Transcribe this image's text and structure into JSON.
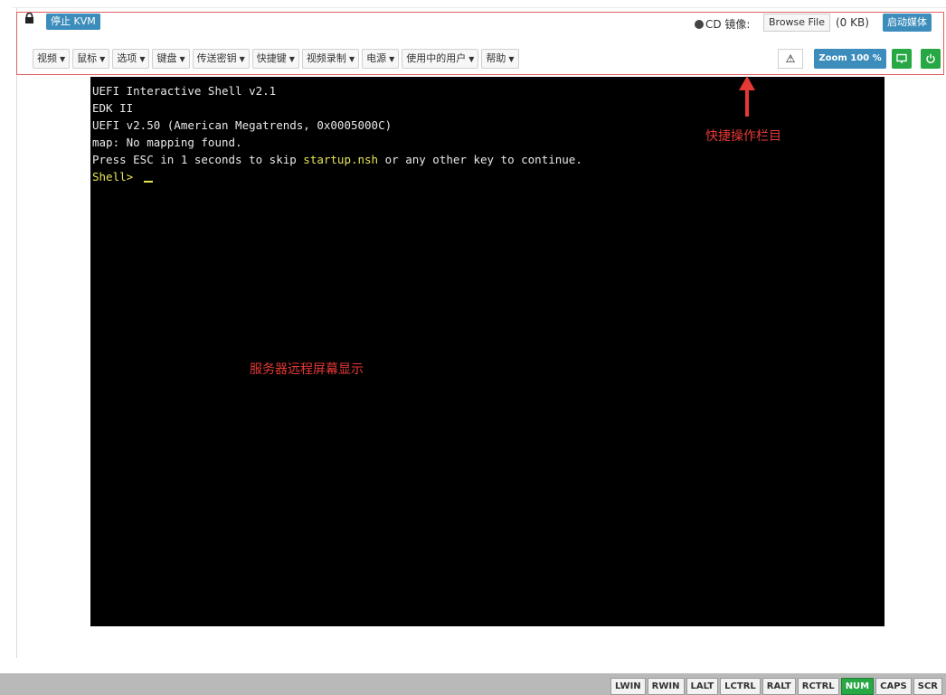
{
  "toolbar": {
    "stop_kvm_label": "停止 KVM",
    "cd_label": "CD 镜像:",
    "browse_file_label": "Browse File",
    "file_size": "(0 KB)",
    "start_media_label": "启动媒体",
    "menus": [
      "视频",
      "鼠标",
      "选项",
      "键盘",
      "传送密钥",
      "快捷键",
      "视频录制",
      "电源",
      "使用中的用户",
      "帮助"
    ],
    "warning_icon": "⚠",
    "zoom_label": "Zoom 100 %"
  },
  "screen": {
    "lines": [
      "UEFI Interactive Shell v2.1",
      "EDK II",
      "UEFI v2.50 (American Megatrends, 0x0005000C)",
      "map: No mapping found."
    ],
    "press_prefix": "Press ESC in 1 seconds to skip ",
    "press_highlight": "startup.nsh",
    "press_suffix": " or any other key to continue.",
    "prompt": "Shell> "
  },
  "annotations": {
    "toolbar_note": "快捷操作栏目",
    "screen_note": "服务器远程屏幕显示"
  },
  "statusbar": {
    "keys": [
      {
        "label": "LWIN",
        "active": false
      },
      {
        "label": "RWIN",
        "active": false
      },
      {
        "label": "LALT",
        "active": false
      },
      {
        "label": "LCTRL",
        "active": false
      },
      {
        "label": "RALT",
        "active": false
      },
      {
        "label": "RCTRL",
        "active": false
      },
      {
        "label": "NUM",
        "active": true
      },
      {
        "label": "CAPS",
        "active": false
      },
      {
        "label": "SCR",
        "active": false
      }
    ]
  },
  "colors": {
    "accent": "#3c8dbc",
    "success": "#28a745",
    "annotation": "#e53935"
  }
}
